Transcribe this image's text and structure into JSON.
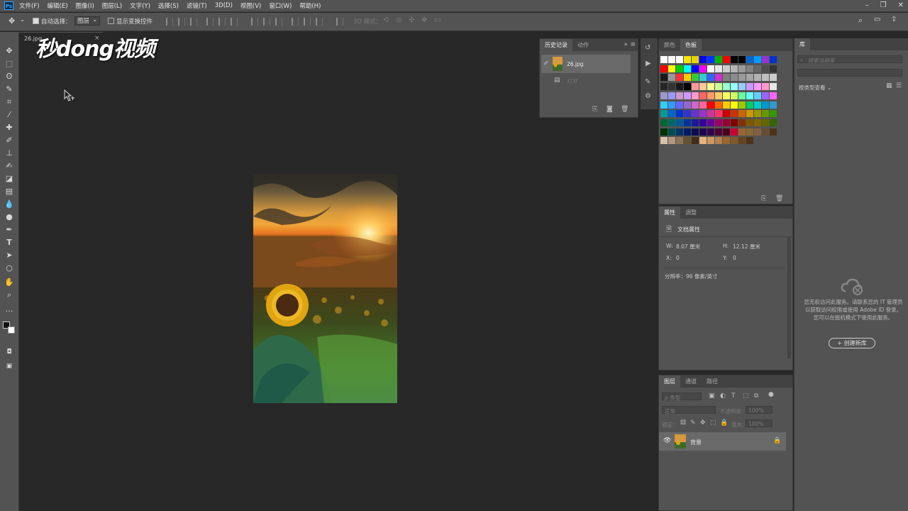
{
  "menu": {
    "logo": "Ps",
    "items": [
      "文件(F)",
      "编辑(E)",
      "图像(I)",
      "图层(L)",
      "文字(Y)",
      "选择(S)",
      "滤镜(T)",
      "3D(D)",
      "视图(V)",
      "窗口(W)",
      "帮助(H)"
    ]
  },
  "options": {
    "auto_select_label": "自动选择：",
    "auto_select_value": "图层",
    "show_transform": "显示变换控件",
    "mode_3d": "3D 模式："
  },
  "document": {
    "tab_label": "26.jpg",
    "close_glyph": "×"
  },
  "watermark": "秒dong视频",
  "history": {
    "tabs": [
      "历史记录",
      "动作"
    ],
    "snapshot_label": "26.jpg",
    "step_label": "打开"
  },
  "swatches": {
    "tabs": [
      "颜色",
      "色板"
    ],
    "rows": [
      [
        "#ffffff",
        "#ffffff",
        "#ffffff",
        "#f5e600",
        "#e6d200",
        "#0000ff",
        "#0033ff",
        "#00b400",
        "#ff0000",
        "#000000",
        "#000000",
        "#0066cc",
        "#0099ff",
        "#9933cc",
        "#0033cc"
      ],
      [
        "#ff0000",
        "#ffff00",
        "#00cc00",
        "#00ffff",
        "#0000ff",
        "#ff00ff",
        "#ffffff",
        "#e6e6e6",
        "#cccccc",
        "#b3b3b3",
        "#999999",
        "#808080",
        "#666666",
        "#4d4d4d",
        "#333333"
      ],
      [
        "#1a1a1a",
        "#999999",
        "#ff3333",
        "#ffcc00",
        "#33cc33",
        "#33cccc",
        "#3366ff",
        "#cc33cc",
        "#808080",
        "#8c8c8c",
        "#999999",
        "#a6a6a6",
        "#b3b3b3",
        "#bfbfbf",
        "#cccccc"
      ],
      [
        "#262626",
        "#333333",
        "#1a1a1a",
        "#000000",
        "#ff9999",
        "#ffcc99",
        "#ffff99",
        "#ccff99",
        "#99ffcc",
        "#99ffff",
        "#99ccff",
        "#cc99ff",
        "#ff99ff",
        "#ff99cc",
        "#e6e6e6"
      ],
      [
        "#9999cc",
        "#9999ff",
        "#cc99cc",
        "#cc99ff",
        "#ff99cc",
        "#ff6666",
        "#ff9966",
        "#ffcc66",
        "#ffff66",
        "#ccff66",
        "#66ff99",
        "#66ffff",
        "#66ccff",
        "#9966ff",
        "#ff66ff"
      ],
      [
        "#33ccff",
        "#3399ff",
        "#6666ff",
        "#9966cc",
        "#cc66cc",
        "#ff6699",
        "#ff0000",
        "#ff6600",
        "#ffcc00",
        "#ffff00",
        "#99cc00",
        "#00cc66",
        "#00cccc",
        "#0099cc",
        "#3399cc"
      ],
      [
        "#009999",
        "#0066cc",
        "#0033cc",
        "#3333cc",
        "#6633cc",
        "#9933cc",
        "#cc3399",
        "#ff3366",
        "#cc0000",
        "#cc3300",
        "#cc6600",
        "#cc9900",
        "#999900",
        "#669900",
        "#339900"
      ],
      [
        "#006633",
        "#006666",
        "#005a99",
        "#003399",
        "#1a1a99",
        "#330099",
        "#660099",
        "#990066",
        "#990033",
        "#800000",
        "#803300",
        "#805500",
        "#806600",
        "#666600",
        "#336600"
      ],
      [
        "#003300",
        "#004d4d",
        "#003366",
        "#001a66",
        "#0d0d4d",
        "#1a004d",
        "#33004d",
        "#4d0033",
        "#4d001a",
        "#cc0033",
        "#996633",
        "#8c6633",
        "#806040",
        "#664d33",
        "#4d3319"
      ],
      [
        "#d9c3a5",
        "#b39980",
        "#8c7359",
        "#665233",
        "#402e1a",
        "#e6b380",
        "#cc9966",
        "#b38050",
        "#996633",
        "#7f5a2a",
        "#66441f",
        "#4d3319"
      ]
    ]
  },
  "properties": {
    "tabs": [
      "属性",
      "调整"
    ],
    "header": "文档属性",
    "w_label": "W:",
    "w_value": "8.07 厘米",
    "h_label": "H:",
    "h_value": "12.12 厘米",
    "x_label": "X:",
    "x_value": "0",
    "y_label": "Y:",
    "y_value": "0",
    "resolution": "分辨率：96 像素/英寸"
  },
  "layers": {
    "tabs": [
      "图层",
      "通道",
      "路径"
    ],
    "filter_placeholder": "ρ 类型",
    "blend_mode": "正常",
    "opacity_label": "不透明度：",
    "opacity_value": "100%",
    "lock_label": "锁定：",
    "fill_label": "填充：",
    "fill_value": "100%",
    "layer_name": "背景"
  },
  "library": {
    "tab": "库",
    "search_placeholder": "搜索当前库",
    "view_label": "按类型查看",
    "message": "您无权访问此服务。请联系您的 IT 管理员以获取访问权限或使用 Adobe ID 登录。您可以在脱机模式下使用此服务。",
    "create_button": "+ 创建新库"
  },
  "colors": {
    "panel_bg": "#535353",
    "canvas_bg": "#282828",
    "accent": "#31a8ff"
  }
}
